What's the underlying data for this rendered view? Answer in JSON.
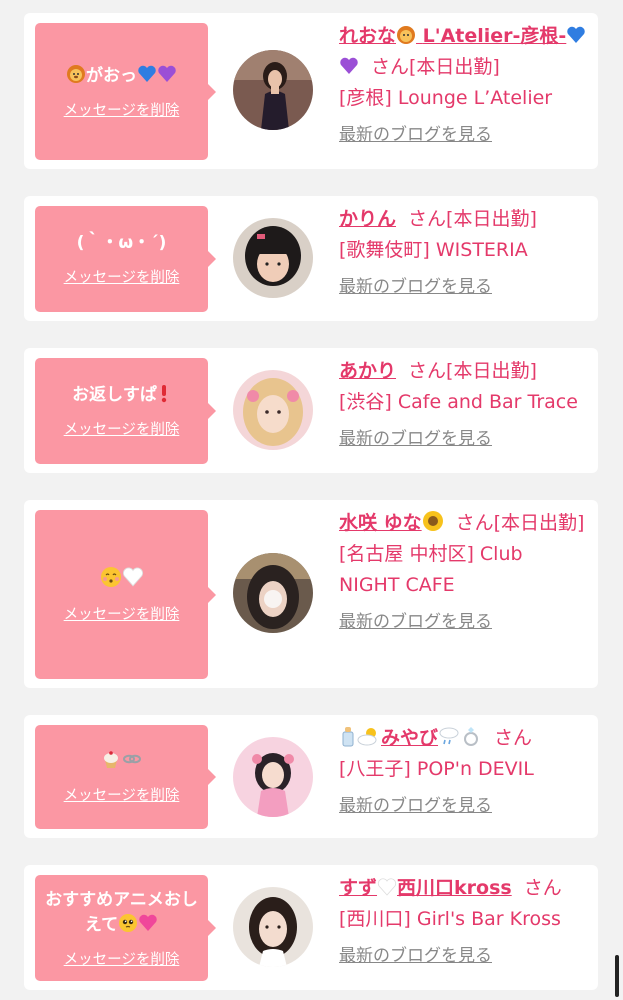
{
  "colors": {
    "background": "#f2f2f2",
    "card": "#ffffff",
    "bubble": "#fb97a3",
    "accent": "#e4396a",
    "link_gray": "#888888"
  },
  "delete_label": "メッセージを削除",
  "blog_label": "最新のブログを見る",
  "honorific": "さん",
  "cards": [
    {
      "message": "がおっ",
      "message_emoji_before": [
        "lion-face"
      ],
      "message_emoji_after": [
        "blue-heart",
        "purple-heart"
      ],
      "name": "れおな",
      "name_emoji_after": [
        "lion-face"
      ],
      "name_suffix": "L'Atelier-彦根-",
      "name_tail_emoji": [
        "blue-heart",
        "purple-heart"
      ],
      "status": "[本日出勤]",
      "shop": "[彦根] Lounge L’Atelier",
      "avatar_icon": "avatar-woman-dark-dress"
    },
    {
      "message": "(｀・ω・´)",
      "name": "かりん",
      "status": "[本日出勤]",
      "shop": "[歌舞伎町] WISTERIA",
      "avatar_icon": "avatar-child-bob-hair"
    },
    {
      "message": "お返しすぱ",
      "message_emoji_after": [
        "exclamation"
      ],
      "name": "あかり",
      "status": "[本日出勤]",
      "shop": "[渋谷] Cafe and Bar Trace",
      "avatar_icon": "avatar-blonde-pink"
    },
    {
      "message": "",
      "message_emoji_after": [
        "kissing-face",
        "white-heart"
      ],
      "name": "水咲 ゆな",
      "name_emoji_after": [
        "sunflower"
      ],
      "status": "[本日出勤]",
      "shop": "[名古屋 中村区] Club NIGHT CAFE",
      "avatar_icon": "avatar-dark-hair"
    },
    {
      "message": "",
      "message_emoji_after": [
        "cupcake",
        "link"
      ],
      "name": "みやび",
      "name_emoji_before": [
        "baby-bottle",
        "sun-cloud"
      ],
      "name_emoji_after": [
        "cloud-rain",
        "ring"
      ],
      "status": "",
      "shop": "[八王子] POP'n DEVIL",
      "avatar_icon": "avatar-pink-idol"
    },
    {
      "message": "おすすめアニメおしえて",
      "message_emoji_after": [
        "pleading-face",
        "pink-heart"
      ],
      "name": "すず",
      "name_emoji_after": [
        "white-heart"
      ],
      "name_suffix": "西川口kross",
      "status": "",
      "shop": "[西川口] Girl's Bar Kross",
      "avatar_icon": "avatar-woman-light"
    }
  ]
}
